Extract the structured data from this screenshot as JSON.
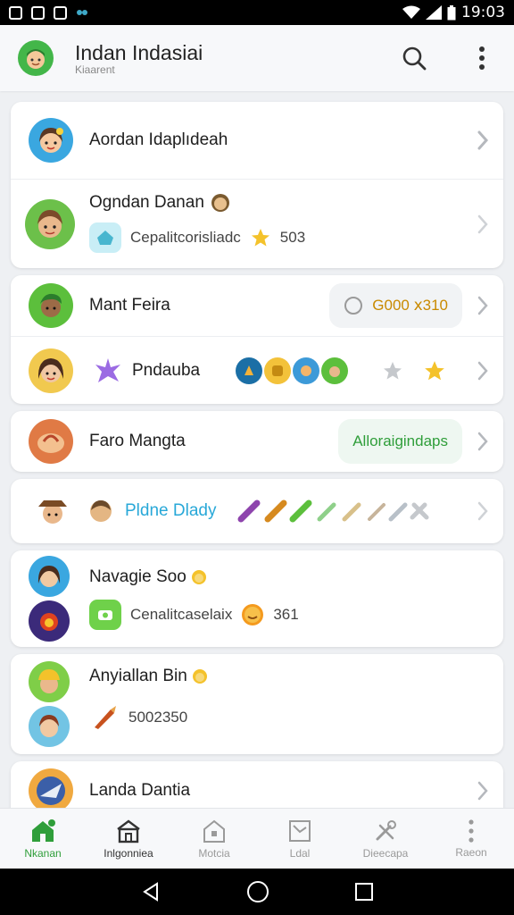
{
  "status_bar": {
    "time": "19:03"
  },
  "header": {
    "title": "Indan Indasiai",
    "subtitle": "Kiaarent"
  },
  "list": {
    "card1": {
      "name": "Aordan Idaplıdeah"
    },
    "card2": {
      "name": "Ogndan Danan",
      "detail": "Cepalitcorisliadc",
      "value": "503"
    },
    "card3": {
      "name": "Mant Feira",
      "pill": "G000 ⅹ310"
    },
    "card4": {
      "name": "Pndauba"
    },
    "card5": {
      "name": "Faro Mangta",
      "pill": "Alloraigindaps"
    },
    "card6": {
      "name": "Pldne Dlady"
    },
    "card7": {
      "name": "Navagie Soo",
      "detail": "Cenalitcaselaix",
      "value": "361"
    },
    "card8": {
      "name": "Anyiallan Bin",
      "value": "5002350"
    },
    "card9": {
      "name": "Landa Dantia"
    }
  },
  "bottom_nav": [
    {
      "label": "Nkanan"
    },
    {
      "label": "Inlgonniea"
    },
    {
      "label": "Motcia"
    },
    {
      "label": "Ldal"
    },
    {
      "label": "Dieecapa"
    },
    {
      "label": "Raeon"
    }
  ],
  "colors": {
    "accent": "#2f9e3a",
    "header_bg": "#f7f8fa",
    "background": "#eef0f3"
  }
}
